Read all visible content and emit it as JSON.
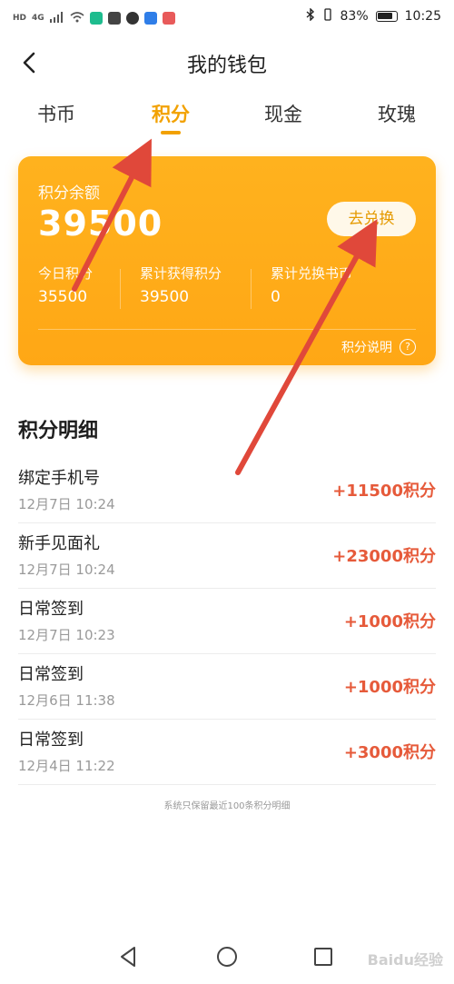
{
  "status_bar": {
    "left_labels": [
      "HD",
      "4G"
    ],
    "battery": "83%",
    "time": "10:25"
  },
  "header": {
    "title": "我的钱包"
  },
  "tabs": [
    {
      "label": "书币"
    },
    {
      "label": "积分"
    },
    {
      "label": "现金"
    },
    {
      "label": "玫瑰"
    }
  ],
  "active_tab": "积分",
  "card": {
    "balance_label": "积分余额",
    "balance": "39500",
    "exchange_button": "去兑换",
    "stats": [
      {
        "label": "今日积分",
        "value": "35500"
      },
      {
        "label": "累计获得积分",
        "value": "39500"
      },
      {
        "label": "累计兑换书币",
        "value": "0"
      }
    ],
    "explain": "积分说明"
  },
  "details": {
    "title": "积分明细",
    "rows": [
      {
        "title": "绑定手机号",
        "time": "12月7日 10:24",
        "points": "+11500积分"
      },
      {
        "title": "新手见面礼",
        "time": "12月7日 10:24",
        "points": "+23000积分"
      },
      {
        "title": "日常签到",
        "time": "12月7日 10:23",
        "points": "+1000积分"
      },
      {
        "title": "日常签到",
        "time": "12月6日 11:38",
        "points": "+1000积分"
      },
      {
        "title": "日常签到",
        "time": "12月4日 11:22",
        "points": "+3000积分"
      }
    ]
  },
  "note": "系统只保留最近100条积分明细",
  "watermark": "Baidu经验",
  "colors": {
    "accent": "#f2a100",
    "card": "#ffab18",
    "points": "#e65a3a",
    "annotation_arrow": "#e0483a"
  },
  "icons": {
    "back": "chevron-left-icon",
    "help": "question-circle-icon",
    "nav": [
      "triangle-back-icon",
      "circle-home-icon",
      "square-recent-icon"
    ]
  }
}
